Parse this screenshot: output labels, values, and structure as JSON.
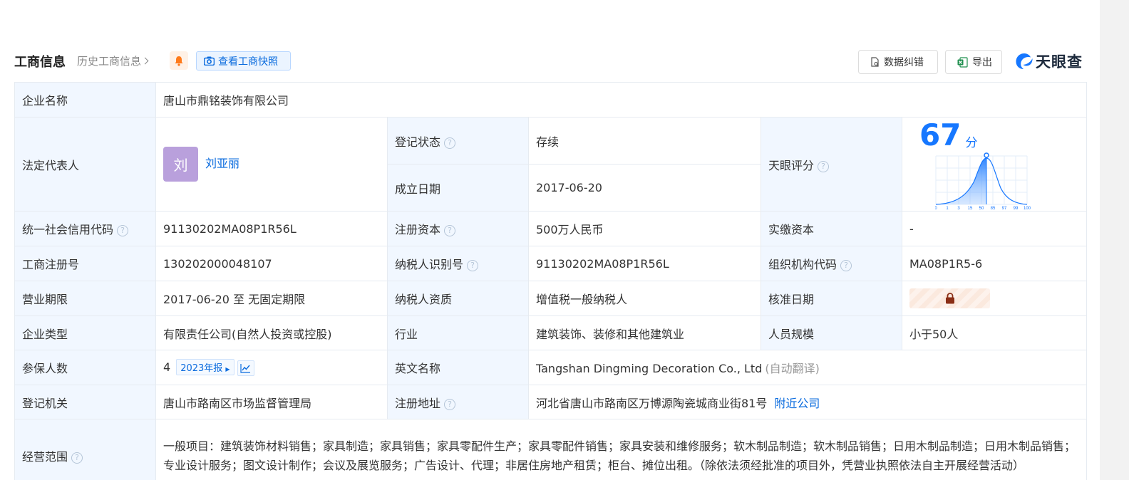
{
  "header": {
    "title": "工商信息",
    "history_label": "历史工商信息",
    "snapshot_label": "查看工商快照",
    "correct_label": "数据纠错",
    "export_label": "导出",
    "logo_text": "天眼查"
  },
  "labels": {
    "company_name": "企业名称",
    "legal_rep": "法定代表人",
    "reg_status": "登记状态",
    "founded": "成立日期",
    "tianyan_score": "天眼评分",
    "credit_code": "统一社会信用代码",
    "reg_capital": "注册资本",
    "paid_capital": "实缴资本",
    "reg_number": "工商注册号",
    "taxpayer_id": "纳税人识别号",
    "org_code": "组织机构代码",
    "term": "营业期限",
    "taxpayer_qual": "纳税人资质",
    "approval_date": "核准日期",
    "company_type": "企业类型",
    "industry": "行业",
    "staff_size": "人员规模",
    "insured": "参保人数",
    "english_name": "英文名称",
    "reg_authority": "登记机关",
    "reg_address": "注册地址",
    "business_scope": "经营范围"
  },
  "values": {
    "company_name": "唐山市鼎铭装饰有限公司",
    "legal_rep_avatar": "刘",
    "legal_rep_name": "刘亚丽",
    "reg_status": "存续",
    "founded": "2017-06-20",
    "score": "67",
    "score_unit": "分",
    "credit_code": "91130202MA08P1R56L",
    "reg_capital": "500万人民币",
    "paid_capital": "-",
    "reg_number": "130202000048107",
    "taxpayer_id": "91130202MA08P1R56L",
    "org_code": "MA08P1R5-6",
    "term": "2017-06-20 至 无固定期限",
    "taxpayer_qual": "增值税一般纳税人",
    "company_type": "有限责任公司(自然人投资或控股)",
    "industry": "建筑装饰、装修和其他建筑业",
    "staff_size": "小于50人",
    "insured": "4",
    "insured_year_tag": "2023年报",
    "english_name": "Tangshan Dingming Decoration Co., Ltd",
    "english_name_note": "(自动翻译)",
    "reg_authority": "唐山市路南区市场监督管理局",
    "reg_address": "河北省唐山市路南区万博源陶瓷城商业街81号",
    "nearby_link": "附近公司",
    "business_scope": "一般项目：建筑装饰材料销售；家具制造；家具销售；家具零配件生产；家具零配件销售；家具安装和维修服务；软木制品制造；软木制品销售；日用木制品制造；日用木制品销售；专业设计服务；图文设计制作；会议及展览服务；广告设计、代理；非居住房地产租赁；柜台、摊位出租。（除依法须经批准的项目外，凭营业执照依法自主开展经营活动）"
  },
  "score_chart": {
    "x_ticks": [
      "0",
      "1",
      "3",
      "15",
      "50",
      "85",
      "97",
      "99",
      "100"
    ],
    "marker_value": "67"
  },
  "colors": {
    "accent": "#1677ff",
    "status_green": "#16a34a",
    "label_bg": "#f1f7ff",
    "avatar_bg": "#b9a0dc"
  },
  "icons": {
    "bell": "bell-icon",
    "camera": "camera-icon",
    "correct": "edit-doc-icon",
    "export": "excel-icon",
    "lock": "lock-icon",
    "trend": "trend-chart-icon",
    "help": "question-circle-icon"
  }
}
